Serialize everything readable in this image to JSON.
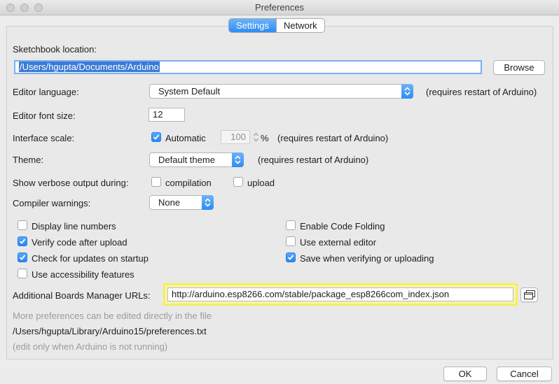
{
  "window": {
    "title": "Preferences"
  },
  "tabs": [
    {
      "label": "Settings",
      "active": true
    },
    {
      "label": "Network",
      "active": false
    }
  ],
  "sketchbook": {
    "label": "Sketchbook location:",
    "value": "/Users/hgupta/Documents/Arduino",
    "browse_label": "Browse"
  },
  "editor_language": {
    "label": "Editor language:",
    "value": "System Default",
    "note": "(requires restart of Arduino)"
  },
  "editor_font_size": {
    "label": "Editor font size:",
    "value": "12"
  },
  "interface_scale": {
    "label": "Interface scale:",
    "automatic_label": "Automatic",
    "automatic_checked": true,
    "value": "100",
    "unit": "%",
    "note": "(requires restart of Arduino)"
  },
  "theme": {
    "label": "Theme:",
    "value": "Default theme",
    "note": "(requires restart of Arduino)"
  },
  "verbose": {
    "label": "Show verbose output during:",
    "compilation_label": "compilation",
    "compilation_checked": false,
    "upload_label": "upload",
    "upload_checked": false
  },
  "compiler_warnings": {
    "label": "Compiler warnings:",
    "value": "None"
  },
  "options_left": [
    {
      "label": "Display line numbers",
      "checked": false
    },
    {
      "label": "Verify code after upload",
      "checked": true
    },
    {
      "label": "Check for updates on startup",
      "checked": true
    },
    {
      "label": "Use accessibility features",
      "checked": false
    }
  ],
  "options_right": [
    {
      "label": "Enable Code Folding",
      "checked": false
    },
    {
      "label": "Use external editor",
      "checked": false
    },
    {
      "label": "Save when verifying or uploading",
      "checked": true
    }
  ],
  "boards_urls": {
    "label": "Additional Boards Manager URLs:",
    "value": "http://arduino.esp8266.com/stable/package_esp8266com_index.json"
  },
  "more_prefs": {
    "hint": "More preferences can be edited directly in the file",
    "path": "/Users/hgupta/Library/Arduino15/preferences.txt",
    "note": "(edit only when Arduino is not running)"
  },
  "footer": {
    "ok_label": "OK",
    "cancel_label": "Cancel"
  },
  "colors": {
    "accent": "#2f8cf3",
    "highlight": "#f5ef5a",
    "selection": "#3b7bd6"
  }
}
